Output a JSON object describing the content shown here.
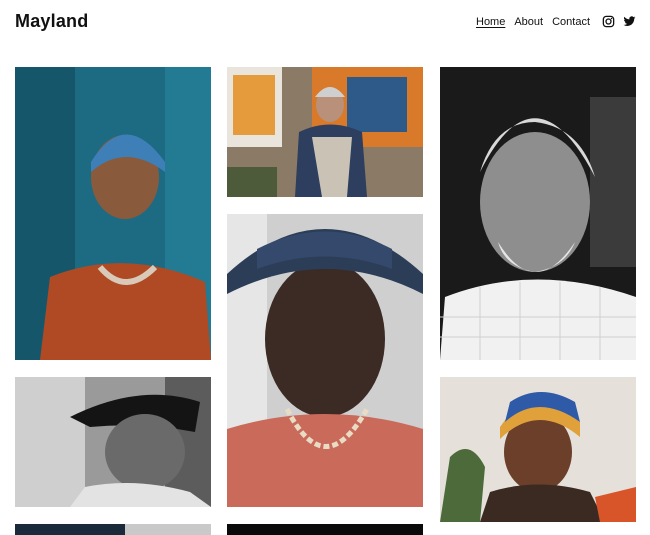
{
  "site": {
    "brand": "Mayland"
  },
  "nav": {
    "items": [
      {
        "label": "Home",
        "active": true
      },
      {
        "label": "About",
        "active": false
      },
      {
        "label": "Contact",
        "active": false
      }
    ]
  },
  "social": {
    "icons": [
      "instagram-icon",
      "twitter-icon"
    ]
  },
  "gallery": {
    "photos": [
      {
        "name": "photo-woman-blue-headscarf",
        "tone": "color",
        "accent": "#1f6f86"
      },
      {
        "name": "photo-man-painter-apron",
        "tone": "color",
        "accent": "#c9692a"
      },
      {
        "name": "photo-old-man-white-beard",
        "tone": "bw",
        "accent": "#444444"
      },
      {
        "name": "photo-man-black-cap-profile",
        "tone": "bw",
        "accent": "#333333"
      },
      {
        "name": "photo-young-man-blue-cap",
        "tone": "color",
        "accent": "#d3826a"
      },
      {
        "name": "photo-woman-colorful-turban",
        "tone": "color",
        "accent": "#d8a23a"
      },
      {
        "name": "photo-partial-bottom-left",
        "tone": "color",
        "accent": "#1b2a3a"
      },
      {
        "name": "photo-partial-bottom-center",
        "tone": "bw",
        "accent": "#0a0a0a"
      }
    ]
  }
}
